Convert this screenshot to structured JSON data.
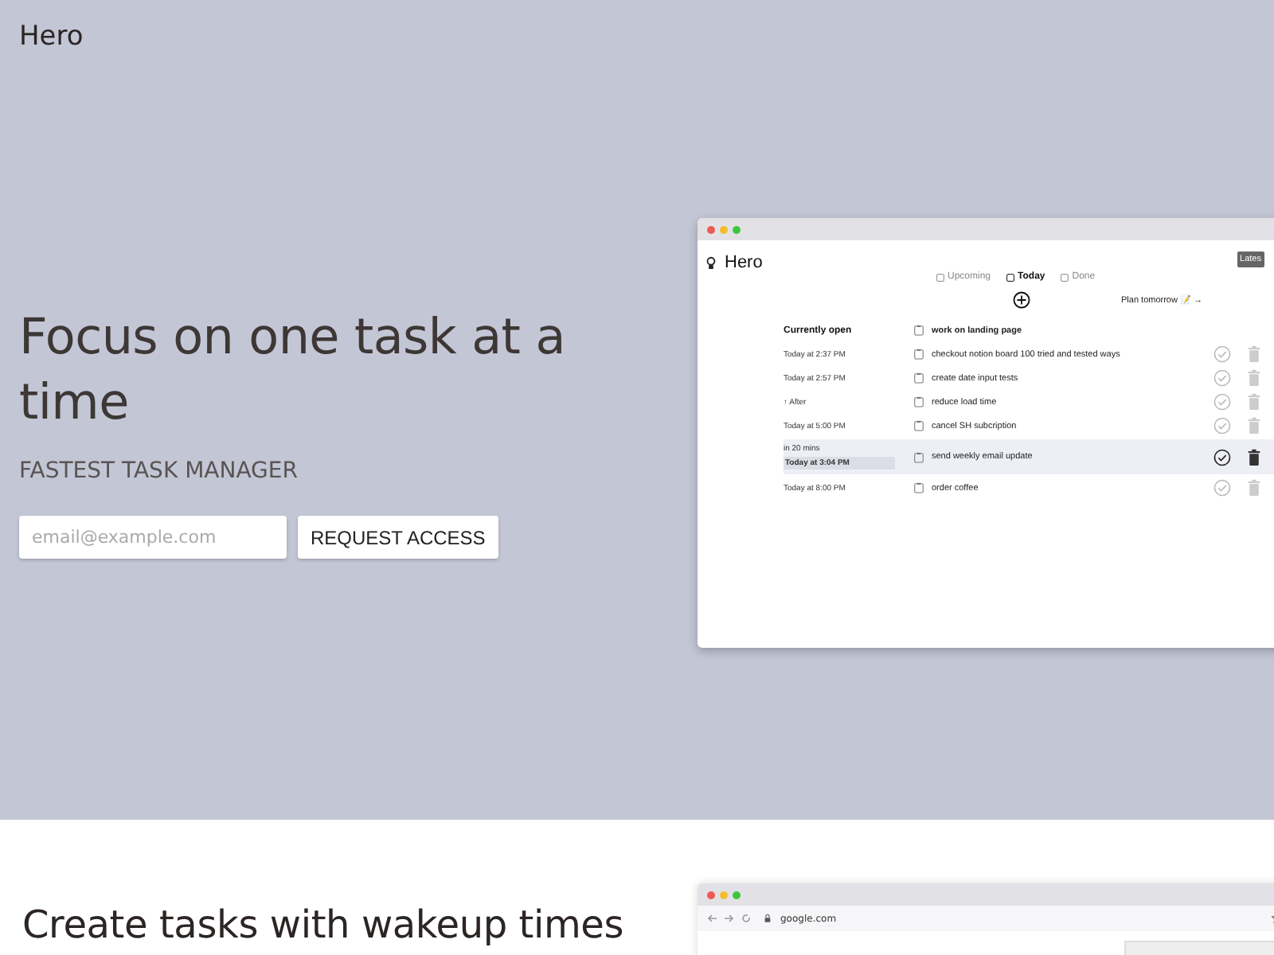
{
  "brand": "Hero",
  "hero": {
    "title": "Focus on one task at a time",
    "subtitle": "FASTEST TASK MANAGER",
    "email": {
      "placeholder": "email@example.com"
    },
    "button": "REQUEST ACCESS"
  },
  "app_window": {
    "logo": "Hero",
    "badge": "Lates",
    "tabs": [
      {
        "label": "Upcoming",
        "selected": false
      },
      {
        "label": "Today",
        "selected": true
      },
      {
        "label": "Done",
        "selected": false
      }
    ],
    "plan_link": "Plan tomorrow 📝 →",
    "column_header": "Currently open",
    "current_task": "work on landing page",
    "tasks": [
      {
        "time": "Today at 2:37 PM",
        "title": "checkout notion board 100 tried and tested ways",
        "selected": false
      },
      {
        "time": "Today at 2:57 PM",
        "title": "create date input tests",
        "selected": false
      },
      {
        "time": "↑ After",
        "title": "reduce load time",
        "selected": false
      },
      {
        "time": "Today at 5:00 PM",
        "title": "cancel SH subcription",
        "selected": false
      },
      {
        "time_note": "in 20 mins",
        "time": "Today at 3:04 PM",
        "title": "send weekly email update",
        "selected": true
      },
      {
        "time": "Today at 8:00 PM",
        "title": "order coffee",
        "selected": false
      }
    ]
  },
  "section2": {
    "title": "Create tasks with wakeup times",
    "browser": {
      "address": "google.com"
    }
  }
}
